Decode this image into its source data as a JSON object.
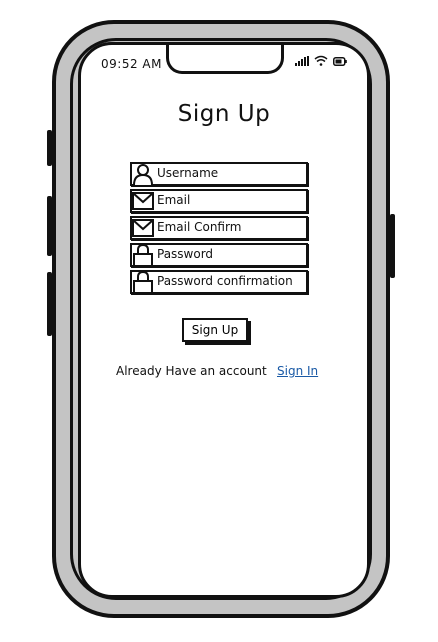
{
  "status_bar": {
    "time": "09:52 AM",
    "icons": [
      "signal-icon",
      "wifi-icon",
      "battery-icon"
    ]
  },
  "form": {
    "title": "Sign Up",
    "fields": [
      {
        "label": "Username",
        "icon": "user-icon"
      },
      {
        "label": "Email",
        "icon": "envelope-icon"
      },
      {
        "label": "Email Confirm",
        "icon": "envelope-icon"
      },
      {
        "label": "Password",
        "icon": "lock-icon"
      },
      {
        "label": "Password confirmation",
        "icon": "lock-icon"
      }
    ],
    "submit_label": "Sign Up",
    "prompt_text": "Already Have an account",
    "signin_link": "Sign In"
  },
  "colors": {
    "frame": "#c4c4c4",
    "outline": "#111111",
    "link": "#1a5aa6"
  }
}
